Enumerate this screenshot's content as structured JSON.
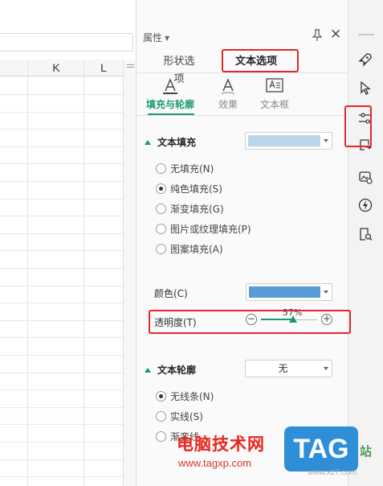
{
  "sheet": {
    "columns": [
      "K",
      "L"
    ]
  },
  "panel": {
    "header": {
      "title": "属性",
      "dropdown_icon": "caret-down-icon",
      "pin_icon": "pin-icon",
      "close_icon": "close-icon",
      "close_glyph": "✕"
    },
    "tabs": [
      {
        "label": "形状选项",
        "active": false
      },
      {
        "label": "文本选项",
        "active": true
      }
    ],
    "subtabs": [
      {
        "label": "填充与轮廓",
        "icon": "text-fill-icon",
        "active": true
      },
      {
        "label": "效果",
        "icon": "text-effect-icon",
        "active": false
      },
      {
        "label": "文本框",
        "icon": "text-box-icon",
        "active": false
      }
    ],
    "text_fill": {
      "title": "文本填充",
      "swatch_color": "#b8d5ea",
      "options": [
        {
          "label": "无填充(N)",
          "checked": false
        },
        {
          "label": "纯色填充(S)",
          "checked": true
        },
        {
          "label": "渐变填充(G)",
          "checked": false
        },
        {
          "label": "图片或纹理填充(P)",
          "checked": false
        },
        {
          "label": "图案填充(A)",
          "checked": false
        }
      ],
      "color_label": "颜色(C)",
      "color_value": "#5b9bd5",
      "transparency_label": "透明度(T)",
      "transparency_value": "57%",
      "transparency_fraction": 0.57,
      "minus_glyph": "−",
      "plus_glyph": "+"
    },
    "text_outline": {
      "title": "文本轮廓",
      "dropdown_value": "无",
      "options": [
        {
          "label": "无线条(N)",
          "checked": true
        },
        {
          "label": "实线(S)",
          "checked": false
        },
        {
          "label": "渐变线",
          "checked": false
        }
      ]
    }
  },
  "right_toolbar": {
    "icons": [
      "rocket-icon",
      "cursor-arrow-icon",
      "properties-sliders-icon",
      "transform-icon",
      "image-tools-icon",
      "lightning-icon",
      "reader-search-icon"
    ]
  },
  "colors": {
    "accent": "#1a9b6c",
    "highlight": "#e3262e"
  },
  "watermark": {
    "line1": "电脑技术网",
    "url": "www.tagxp.com",
    "badge": "TAG",
    "site": "站",
    "xz": "www.xz7.com"
  }
}
